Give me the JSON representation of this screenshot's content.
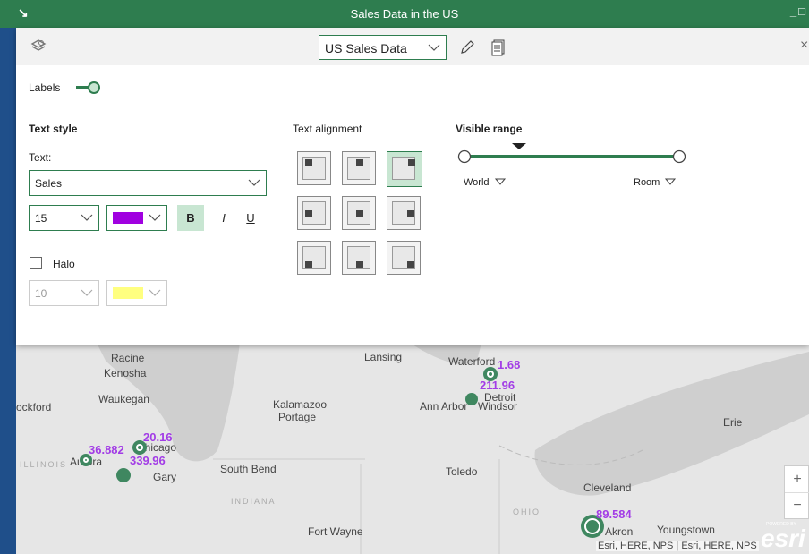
{
  "window": {
    "title": "Sales Data in the US",
    "min": "_",
    "max": "□",
    "close": "×"
  },
  "toolbar": {
    "layer_selected": "US Sales Data"
  },
  "labels_toggle": {
    "label": "Labels",
    "on": true
  },
  "text_style": {
    "heading": "Text style",
    "text_label": "Text:",
    "field_value": "Sales",
    "size_value": "15",
    "color": "#a000e0",
    "bold": "B",
    "italic": "I",
    "underline": "U",
    "halo_label": "Halo",
    "halo_checked": false,
    "halo_size": "10",
    "halo_color": "#ffff80"
  },
  "text_alignment": {
    "heading": "Text alignment",
    "selected": "top-right"
  },
  "visible_range": {
    "heading": "Visible range",
    "min_label": "World",
    "max_label": "Room"
  },
  "map": {
    "places": [
      "Racine",
      "Kenosha",
      "Waukegan",
      "ockford",
      "Kalamazoo",
      "Portage",
      "Lansing",
      "Waterford",
      "Detroit",
      "Ann Arbor",
      "Windsor",
      "Erie",
      "Chicago",
      "Aurora",
      "Gary",
      "South Bend",
      "Toledo",
      "Cleveland",
      "Fort Wayne",
      "Akron",
      "Youngstown"
    ],
    "regions": [
      "ILLINOIS",
      "INDIANA",
      "OHIO"
    ],
    "values": [
      "1.68",
      "211.96",
      "20.16",
      "36.882",
      "339.96",
      "89.584"
    ],
    "attribution": "Esri, HERE, NPS | Esri, HERE, NPS",
    "zoom_in": "+",
    "zoom_out": "−",
    "logo": "esri",
    "powered_by": "POWERED BY"
  }
}
